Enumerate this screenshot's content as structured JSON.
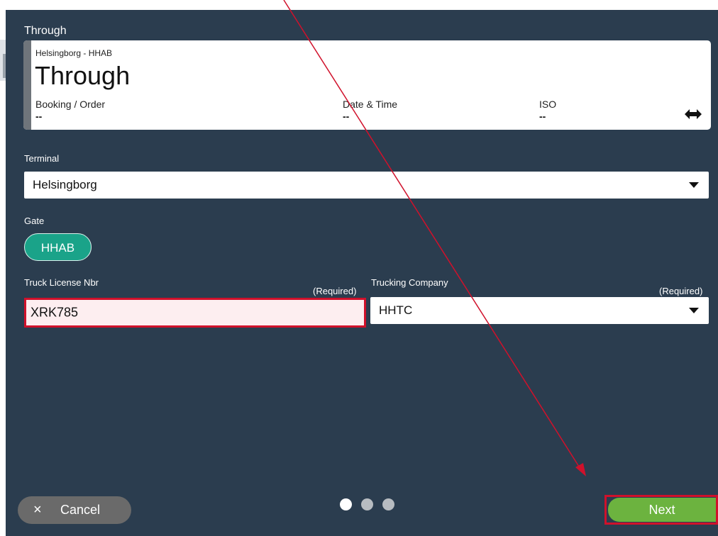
{
  "header": {
    "title": "Through"
  },
  "card": {
    "subtitle": "Helsingborg - HHAB",
    "heading": "Through",
    "columns": [
      {
        "label": "Booking / Order",
        "value": "--"
      },
      {
        "label": "Date & Time",
        "value": "--"
      },
      {
        "label": "ISO",
        "value": "--"
      }
    ],
    "swap_icon": "double-arrow-icon"
  },
  "terminal": {
    "label": "Terminal",
    "value": "Helsingborg"
  },
  "gate": {
    "label": "Gate",
    "selected": "HHAB"
  },
  "truck_license": {
    "label": "Truck License Nbr",
    "required": "(Required)",
    "value": "XRK785"
  },
  "trucking_company": {
    "label": "Trucking Company",
    "required": "(Required)",
    "value": "HHTC"
  },
  "pager": {
    "total": 3,
    "active": 0
  },
  "footer": {
    "cancel_label": "Cancel",
    "cancel_icon": "×",
    "next_label": "Next"
  },
  "colors": {
    "background": "#2b3d4f",
    "gate_accent": "#1aa389",
    "next_button": "#6cb33f",
    "error_highlight": "#d0112b",
    "annotation_arrow": "#d0112b"
  }
}
